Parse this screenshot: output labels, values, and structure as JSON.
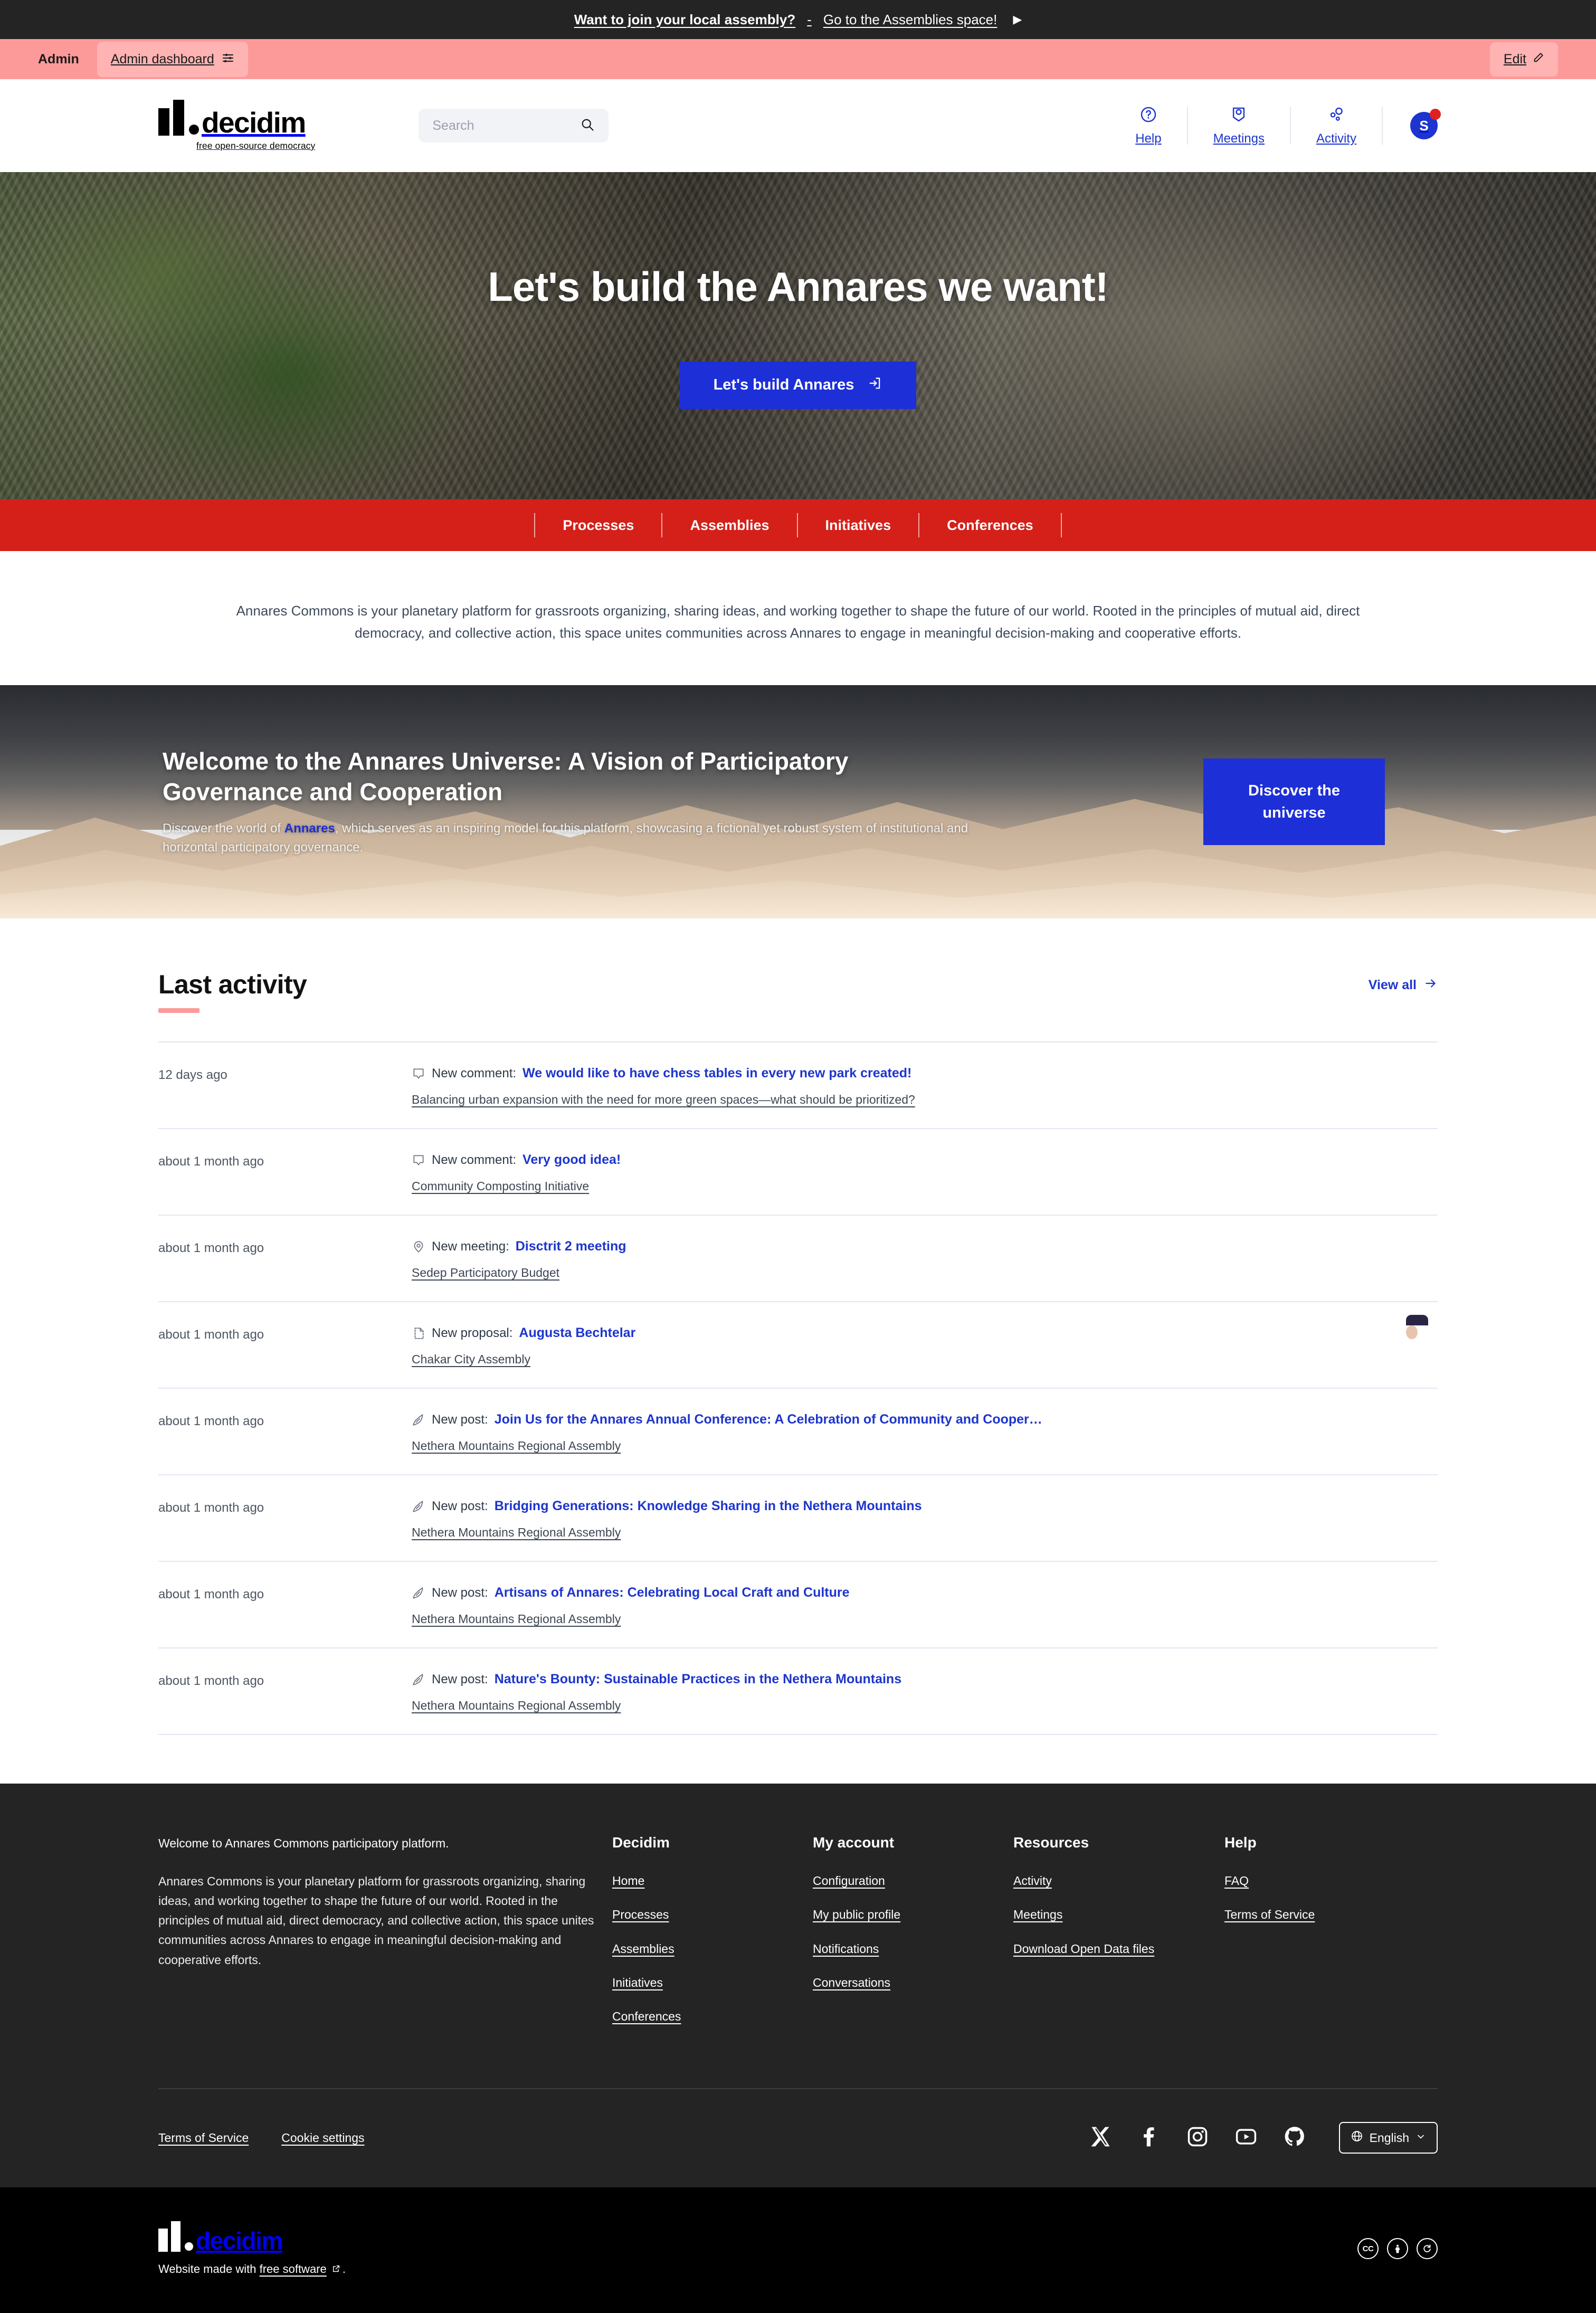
{
  "announcement": {
    "question": "Want to join your local assembly?",
    "separator": "-",
    "link": "Go to the Assemblies space!",
    "arrow_icon": "play-arrow-icon"
  },
  "admin_bar": {
    "label": "Admin",
    "dashboard_label": "Admin dashboard",
    "dashboard_icon": "sliders-icon",
    "edit_label": "Edit",
    "edit_icon": "pencil-icon"
  },
  "header": {
    "logo_word": "decidim",
    "logo_tagline": "free open-source democracy",
    "search": {
      "placeholder": "Search",
      "value": "",
      "icon": "search-icon"
    },
    "nav": [
      {
        "label": "Help",
        "icon": "question-circle-icon"
      },
      {
        "label": "Meetings",
        "icon": "map-pin-icon"
      },
      {
        "label": "Activity",
        "icon": "activity-dots-icon"
      }
    ],
    "account": {
      "initial": "S",
      "has_notification": true
    }
  },
  "hero": {
    "title": "Let's build the Annares we want!",
    "cta_label": "Let's build Annares",
    "cta_icon": "login-icon"
  },
  "main_nav": {
    "items": [
      "Processes",
      "Assemblies",
      "Initiatives",
      "Conferences"
    ]
  },
  "intro": {
    "text": "Annares Commons is your planetary platform for grassroots organizing, sharing ideas, and working together to shape the future of our world. Rooted in the principles of mutual aid, direct democracy, and collective action, this space unites communities across Annares to engage in meaningful decision-making and cooperative efforts."
  },
  "welcome_banner": {
    "heading": "Welcome to the Annares Universe: A Vision of Participatory Governance and Cooperation",
    "body_before": "Discover the world of ",
    "body_link": "Annares",
    "body_after": ", which serves as an inspiring model for this platform, showcasing a fictional yet robust system of institutional and horizontal participatory governance.",
    "cta_label": "Discover the universe"
  },
  "last_activity": {
    "title": "Last activity",
    "view_all_label": "View all",
    "view_all_icon": "arrow-right-icon",
    "rows": [
      {
        "time": "12 days ago",
        "icon": "comment-icon",
        "kind": "New comment:",
        "title": "We would like to have chess tables in every new park created!",
        "context": "Balancing urban expansion with the need for more green spaces—what should be prioritized?",
        "avatar": "placeholder"
      },
      {
        "time": "about 1 month ago",
        "icon": "comment-icon",
        "kind": "New comment:",
        "title": "Very good idea!",
        "context": "Community Composting Initiative",
        "avatar": "placeholder"
      },
      {
        "time": "about 1 month ago",
        "icon": "map-pin-icon",
        "kind": "New meeting:",
        "title": "Disctrit 2 meeting",
        "context": "Sedep Participatory Budget",
        "avatar": "none"
      },
      {
        "time": "about 1 month ago",
        "icon": "proposal-icon",
        "kind": "New proposal:",
        "title": "Augusta Bechtelar",
        "context": "Chakar City Assembly",
        "avatar": "photo"
      },
      {
        "time": "about 1 month ago",
        "icon": "pen-icon",
        "kind": "New post:",
        "title": "Join Us for the Annares Annual Conference: A Celebration of Community and Cooper…",
        "context": "Nethera Mountains Regional Assembly",
        "avatar": "none"
      },
      {
        "time": "about 1 month ago",
        "icon": "pen-icon",
        "kind": "New post:",
        "title": "Bridging Generations: Knowledge Sharing in the Nethera Mountains",
        "context": "Nethera Mountains Regional Assembly",
        "avatar": "none"
      },
      {
        "time": "about 1 month ago",
        "icon": "pen-icon",
        "kind": "New post:",
        "title": "Artisans of Annares: Celebrating Local Craft and Culture",
        "context": "Nethera Mountains Regional Assembly",
        "avatar": "none"
      },
      {
        "time": "about 1 month ago",
        "icon": "pen-icon",
        "kind": "New post:",
        "title": "Nature's Bounty: Sustainable Practices in the Nethera Mountains",
        "context": "Nethera Mountains Regional Assembly",
        "avatar": "none"
      }
    ]
  },
  "footer": {
    "about_lead": "Welcome to Annares Commons participatory platform.",
    "about_body": "Annares Commons is your planetary platform for grassroots organizing, sharing ideas, and working together to shape the future of our world. Rooted in the principles of mutual aid, direct democracy, and collective action, this space unites communities across Annares to engage in meaningful decision-making and cooperative efforts.",
    "columns": [
      {
        "title": "Decidim",
        "links": [
          "Home",
          "Processes",
          "Assemblies",
          "Initiatives",
          "Conferences"
        ]
      },
      {
        "title": "My account",
        "links": [
          "Configuration",
          "My public profile",
          "Notifications",
          "Conversations"
        ]
      },
      {
        "title": "Resources",
        "links": [
          "Activity",
          "Meetings",
          "Download Open Data files"
        ]
      },
      {
        "title": "Help",
        "links": [
          "FAQ",
          "Terms of Service"
        ]
      }
    ],
    "bottom_links": [
      "Terms of Service",
      "Cookie settings"
    ],
    "social": [
      "x-icon",
      "facebook-icon",
      "instagram-icon",
      "youtube-icon",
      "github-icon"
    ],
    "language": {
      "label": "English",
      "icon": "globe-icon",
      "chevron": "chevron-down-icon"
    }
  },
  "sub_footer": {
    "logo_word": "decidim",
    "made_prefix": "Website made with ",
    "made_link": "free software",
    "made_suffix": ".",
    "external_icon": "external-link-icon",
    "licenses": [
      "CC",
      "BY",
      "SA"
    ]
  },
  "colors": {
    "announce_bg": "#242424",
    "admin_bg": "#fc9a9a",
    "brand_blue": "#1d35ce",
    "nav_red": "#d42019",
    "footer_bg": "#242424",
    "subfooter_bg": "#000000"
  }
}
